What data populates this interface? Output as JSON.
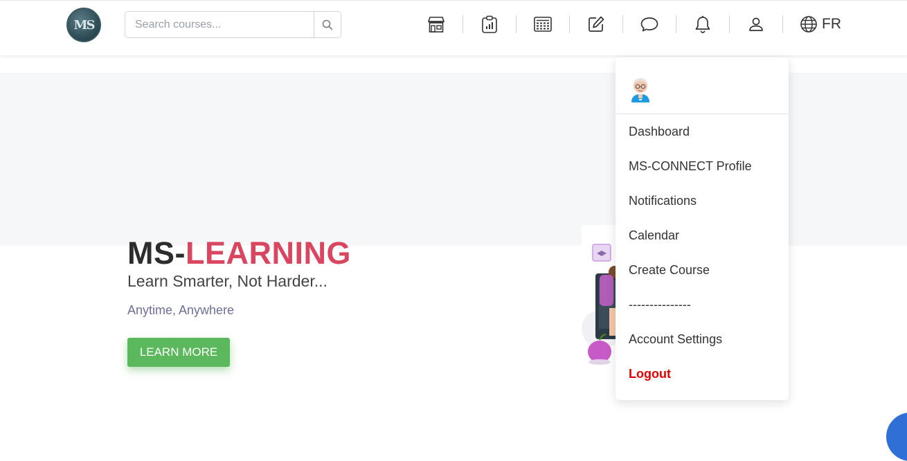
{
  "header": {
    "logo_text": "MS",
    "search": {
      "placeholder": "Search courses...",
      "value": ""
    },
    "nav_icons": [
      "store-icon",
      "clipboard-chart-icon",
      "calculator-icon",
      "edit-icon",
      "chat-icon",
      "bell-icon",
      "user-icon"
    ],
    "language": "FR"
  },
  "hero": {
    "title_prefix": "MS-",
    "title_accent": "LEARNING",
    "subtitle": "Learn Smarter, Not Harder...",
    "tagline": "Anytime, Anywhere",
    "cta_label": "LEARN MORE",
    "accent_color": "#d9465f",
    "cta_color": "#5cb85c"
  },
  "user_menu": {
    "items": [
      {
        "label": "Dashboard"
      },
      {
        "label": "MS-CONNECT Profile"
      },
      {
        "label": "Notifications"
      },
      {
        "label": "Calendar"
      },
      {
        "label": "Create Course"
      },
      {
        "label": "---------------"
      },
      {
        "label": "Account Settings"
      },
      {
        "label": "Logout"
      }
    ],
    "logout_color": "#e00000"
  }
}
